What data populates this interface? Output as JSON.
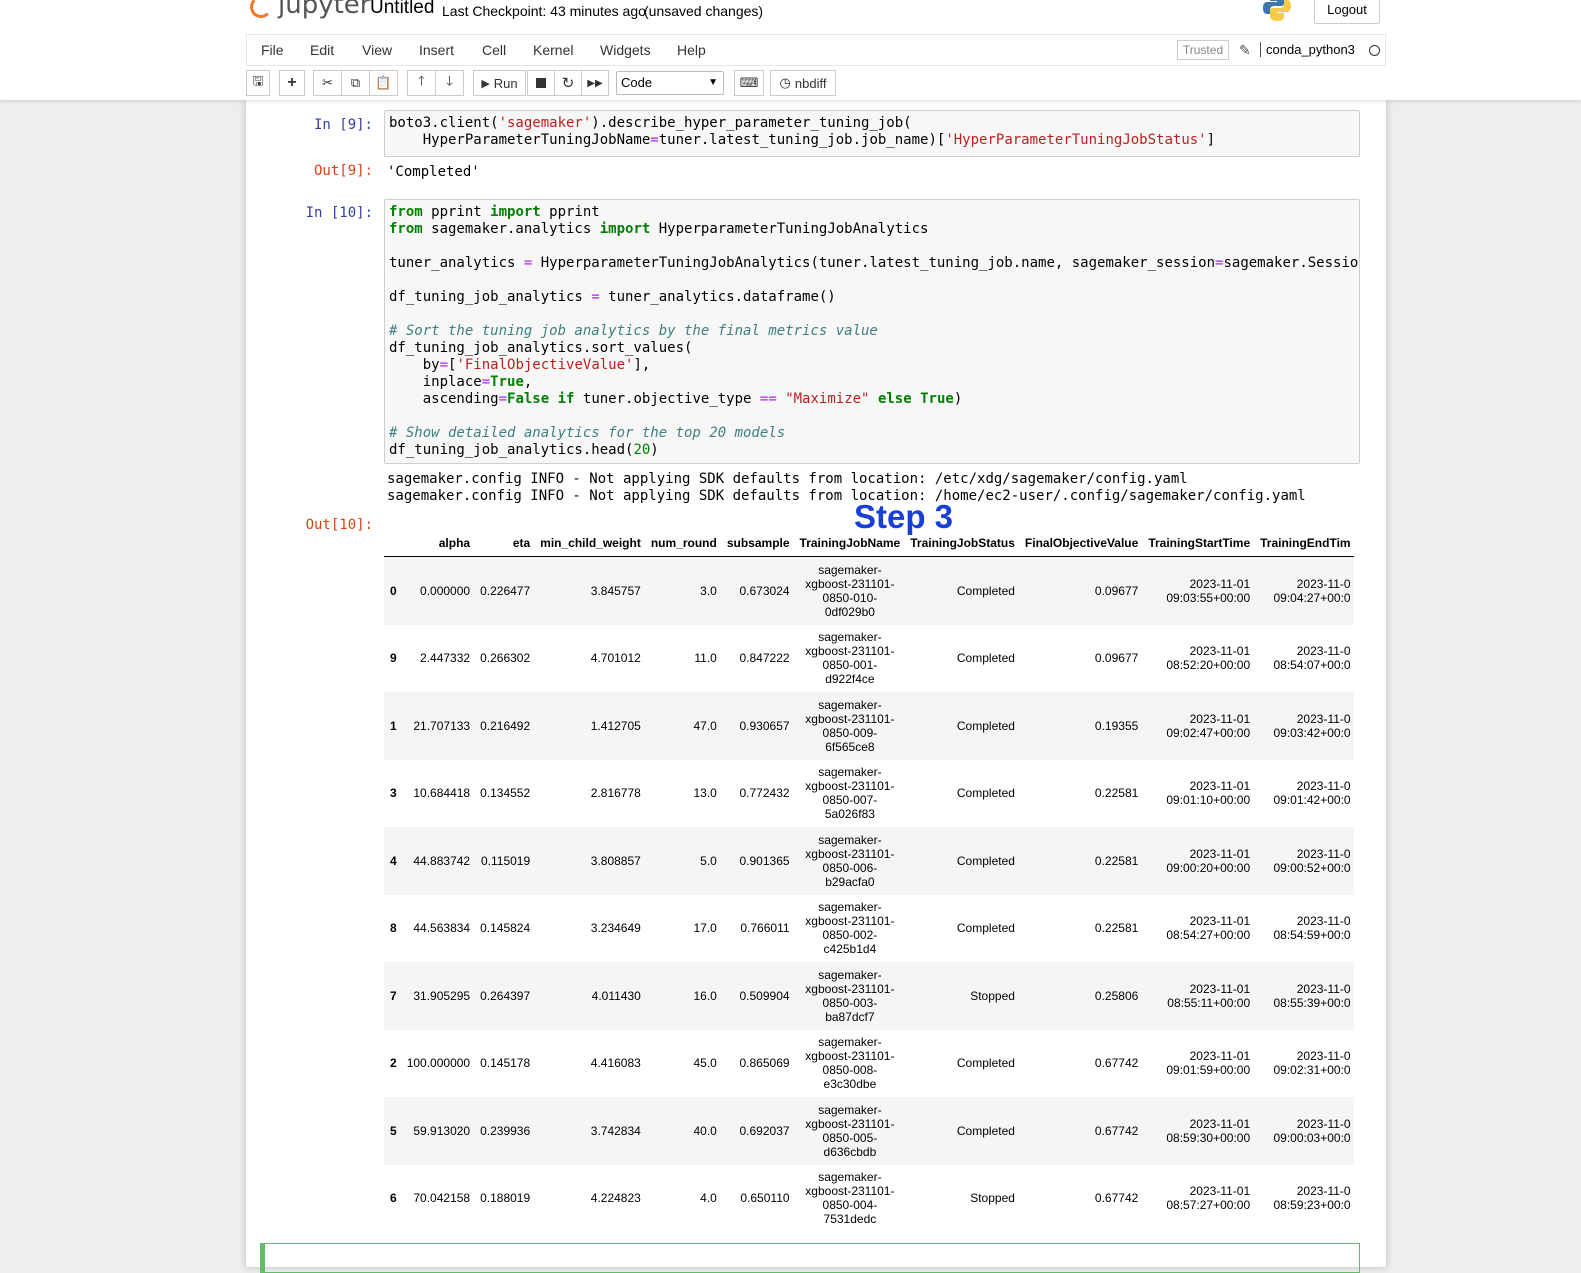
{
  "header": {
    "logo_text": "jupyter",
    "title": "Untitled",
    "checkpoint": "Last Checkpoint: 43 minutes ago",
    "dirty": "(unsaved changes)",
    "logout": "Logout"
  },
  "menu": {
    "items": [
      "File",
      "Edit",
      "View",
      "Insert",
      "Cell",
      "Kernel",
      "Widgets",
      "Help"
    ],
    "trusted": "Trusted",
    "kernel": "conda_python3"
  },
  "toolbar": {
    "run": "Run",
    "cell_type": "Code",
    "nbdiff": "nbdiff"
  },
  "cells": {
    "c9": {
      "in_prompt": "In [9]:",
      "out_prompt": "Out[9]:",
      "output": "'Completed'"
    },
    "c10": {
      "in_prompt": "In [10]:",
      "out_prompt": "Out[10]:",
      "stdout": [
        "sagemaker.config INFO - Not applying SDK defaults from location: /etc/xdg/sagemaker/config.yaml",
        "sagemaker.config INFO - Not applying SDK defaults from location: /home/ec2-user/.config/sagemaker/config.yaml"
      ]
    }
  },
  "annotation": "Step 3",
  "dataframe": {
    "columns": [
      "",
      "alpha",
      "eta",
      "min_child_weight",
      "num_round",
      "subsample",
      "TrainingJobName",
      "TrainingJobStatus",
      "FinalObjectiveValue",
      "TrainingStartTime",
      "TrainingEndTim"
    ],
    "rows": [
      [
        "0",
        "0.000000",
        "0.226477",
        "3.845757",
        "3.0",
        "0.673024",
        "sagemaker-\nxgboost-231101-\n0850-010-\n0df029b0",
        "Completed",
        "0.09677",
        "2023-11-01\n09:03:55+00:00",
        "2023-11-0\n09:04:27+00:0"
      ],
      [
        "9",
        "2.447332",
        "0.266302",
        "4.701012",
        "11.0",
        "0.847222",
        "sagemaker-\nxgboost-231101-\n0850-001-\nd922f4ce",
        "Completed",
        "0.09677",
        "2023-11-01\n08:52:20+00:00",
        "2023-11-0\n08:54:07+00:0"
      ],
      [
        "1",
        "21.707133",
        "0.216492",
        "1.412705",
        "47.0",
        "0.930657",
        "sagemaker-\nxgboost-231101-\n0850-009-\n6f565ce8",
        "Completed",
        "0.19355",
        "2023-11-01\n09:02:47+00:00",
        "2023-11-0\n09:03:42+00:0"
      ],
      [
        "3",
        "10.684418",
        "0.134552",
        "2.816778",
        "13.0",
        "0.772432",
        "sagemaker-\nxgboost-231101-\n0850-007-\n5a026f83",
        "Completed",
        "0.22581",
        "2023-11-01\n09:01:10+00:00",
        "2023-11-0\n09:01:42+00:0"
      ],
      [
        "4",
        "44.883742",
        "0.115019",
        "3.808857",
        "5.0",
        "0.901365",
        "sagemaker-\nxgboost-231101-\n0850-006-\nb29acfa0",
        "Completed",
        "0.22581",
        "2023-11-01\n09:00:20+00:00",
        "2023-11-0\n09:00:52+00:0"
      ],
      [
        "8",
        "44.563834",
        "0.145824",
        "3.234649",
        "17.0",
        "0.766011",
        "sagemaker-\nxgboost-231101-\n0850-002-\nc425b1d4",
        "Completed",
        "0.22581",
        "2023-11-01\n08:54:27+00:00",
        "2023-11-0\n08:54:59+00:0"
      ],
      [
        "7",
        "31.905295",
        "0.264397",
        "4.011430",
        "16.0",
        "0.509904",
        "sagemaker-\nxgboost-231101-\n0850-003-\nba87dcf7",
        "Stopped",
        "0.25806",
        "2023-11-01\n08:55:11+00:00",
        "2023-11-0\n08:55:39+00:0"
      ],
      [
        "2",
        "100.000000",
        "0.145178",
        "4.416083",
        "45.0",
        "0.865069",
        "sagemaker-\nxgboost-231101-\n0850-008-\ne3c30dbe",
        "Completed",
        "0.67742",
        "2023-11-01\n09:01:59+00:00",
        "2023-11-0\n09:02:31+00:0"
      ],
      [
        "5",
        "59.913020",
        "0.239936",
        "3.742834",
        "40.0",
        "0.692037",
        "sagemaker-\nxgboost-231101-\n0850-005-\nd636cbdb",
        "Completed",
        "0.67742",
        "2023-11-01\n08:59:30+00:00",
        "2023-11-0\n09:00:03+00:0"
      ],
      [
        "6",
        "70.042158",
        "0.188019",
        "4.224823",
        "4.0",
        "0.650110",
        "sagemaker-\nxgboost-231101-\n0850-004-\n7531dedc",
        "Stopped",
        "0.67742",
        "2023-11-01\n08:57:27+00:00",
        "2023-11-0\n08:59:23+00:0"
      ]
    ]
  }
}
